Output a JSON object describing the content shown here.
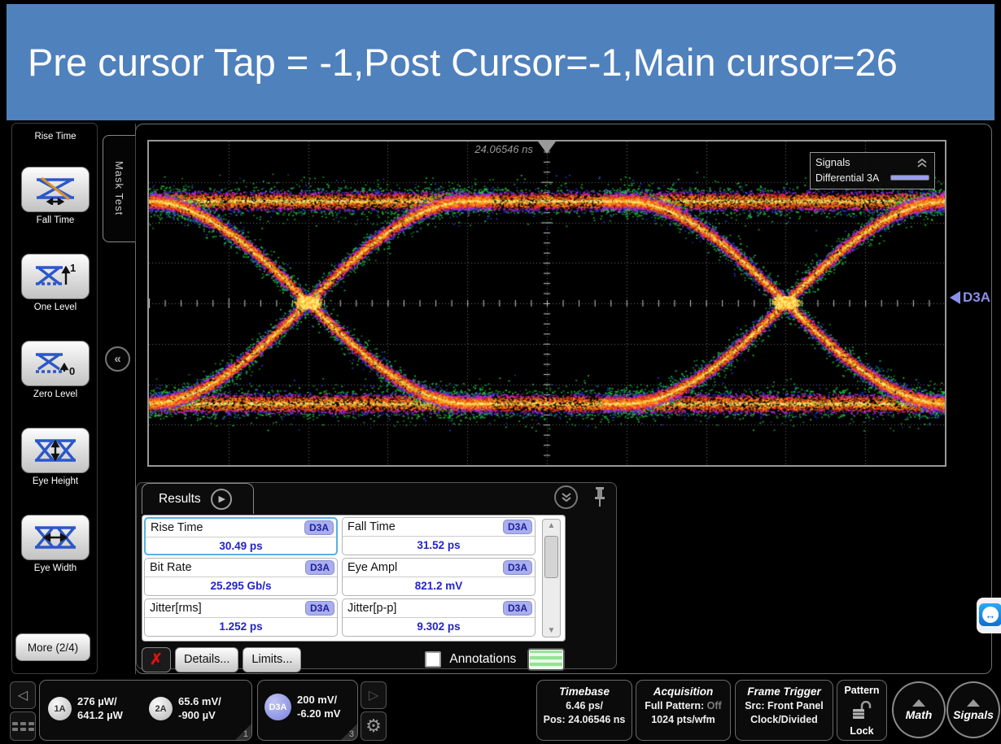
{
  "banner": {
    "title": "Pre cursor Tap = -1,Post Cursor=-1,Main cursor=26"
  },
  "sidebar": {
    "items": [
      {
        "label": "Rise Time",
        "icon": "rise-time-icon"
      },
      {
        "label": "Fall Time",
        "icon": "fall-time-icon"
      },
      {
        "label": "One Level",
        "icon": "one-level-icon"
      },
      {
        "label": "Zero Level",
        "icon": "zero-level-icon"
      },
      {
        "label": "Eye Height",
        "icon": "eye-height-icon"
      },
      {
        "label": "Eye Width",
        "icon": "eye-width-icon"
      }
    ],
    "more_label": "More (2/4)",
    "mask_test_label": "Mask Test",
    "collapse_glyph": "«"
  },
  "plot": {
    "marker_time": "24.06546 ns",
    "legend": {
      "title": "Signals",
      "series": "Differential 3A",
      "swatch_color": "#9aa0e8"
    },
    "channel_label": "D3A",
    "eye_colors": {
      "core": "#fff07a",
      "hot": "#ffa41e",
      "red": "#ee3a1c",
      "magenta": "#d42fd4",
      "blue": "#2b3de8",
      "green": "#1fcc3f"
    }
  },
  "results": {
    "tab_label": "Results",
    "measurements": [
      {
        "name": "Rise Time",
        "source": "D3A",
        "value": "30.49 ps"
      },
      {
        "name": "Fall Time",
        "source": "D3A",
        "value": "31.52 ps"
      },
      {
        "name": "Bit Rate",
        "source": "D3A",
        "value": "25.295 Gb/s"
      },
      {
        "name": "Eye Ampl",
        "source": "D3A",
        "value": "821.2 mV"
      },
      {
        "name": "Jitter[rms]",
        "source": "D3A",
        "value": "1.252 ps"
      },
      {
        "name": "Jitter[p-p]",
        "source": "D3A",
        "value": "9.302 ps"
      }
    ],
    "close_glyph": "✗",
    "details_label": "Details...",
    "limits_label": "Limits...",
    "annotations_label": "Annotations"
  },
  "status_bar": {
    "channels": [
      {
        "id": "1A",
        "line1": "276 µW/",
        "line2": "641.2 µW"
      },
      {
        "id": "2A",
        "line1": "65.6 mV/",
        "line2": "-900 µV"
      }
    ],
    "panel1_corner": "1",
    "d3a": {
      "id": "D3A",
      "line1": "200 mV/",
      "line2": "-6.20 mV"
    },
    "panel2_corner": "3",
    "timebase": {
      "title": "Timebase",
      "line1": "6.46 ps/",
      "line2": "Pos: 24.06546 ns"
    },
    "acquisition": {
      "title": "Acquisition",
      "line1_prefix": "Full Pattern:",
      "line1_value": "Off",
      "line2": "1024 pts/wfm"
    },
    "frame_trigger": {
      "title": "Frame Trigger",
      "line1": "Src: Front Panel",
      "line2": "Clock/Divided"
    },
    "pattern_lock": {
      "top": "Pattern",
      "bottom": "Lock"
    },
    "math_label": "Math",
    "signals_label": "Signals"
  }
}
